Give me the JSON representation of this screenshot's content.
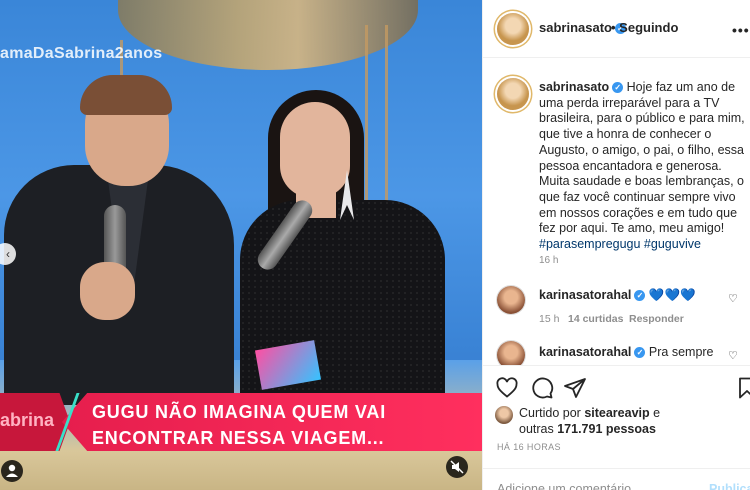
{
  "media": {
    "hashtag_overlay": "amaDaSabrina2anos",
    "chyron_side": "abrina",
    "chyron_line1": "GUGU NÃO IMAGINA QUEM VAI",
    "chyron_line2": "ENCONTRAR NESSA VIAGEM..."
  },
  "header": {
    "username": "sabrinasato",
    "follow_label": "• Seguindo",
    "more": "•••"
  },
  "caption": {
    "username": "sabrinasato",
    "text": " Hoje faz um ano de uma perda irreparável para a TV brasileira, para o público e para mim, que tive a honra de conhecer o Augusto, o amigo, o pai, o filho, essa pessoa encantadora e generosa. Muita saudade e boas lembranças, o que faz você continuar sempre vivo em nossos corações e em tudo que fez por aqui. Te amo, meu amigo!",
    "hashtags": "#parasempregugu #guguvive",
    "time": "16 h"
  },
  "comments": [
    {
      "username": "karinasatorahal",
      "text": "💙💙💙",
      "time": "15 h",
      "likes": "14 curtidas",
      "reply": "Responder"
    },
    {
      "username": "karinasatorahal",
      "text": "Pra sempre"
    }
  ],
  "actions": {
    "liked_prefix": "Curtido por ",
    "liked_user": "siteareavip",
    "liked_mid": " e",
    "liked_line2_prefix": "outras ",
    "liked_count": "171.791 pessoas",
    "post_time": "HÁ 16 HORAS",
    "comment_placeholder": "Adicione um comentário...",
    "publish_label": "Publicar"
  },
  "colors": {
    "accent_link": "#00376b",
    "verified": "#3897f0",
    "chyron": "#e61e4d"
  }
}
